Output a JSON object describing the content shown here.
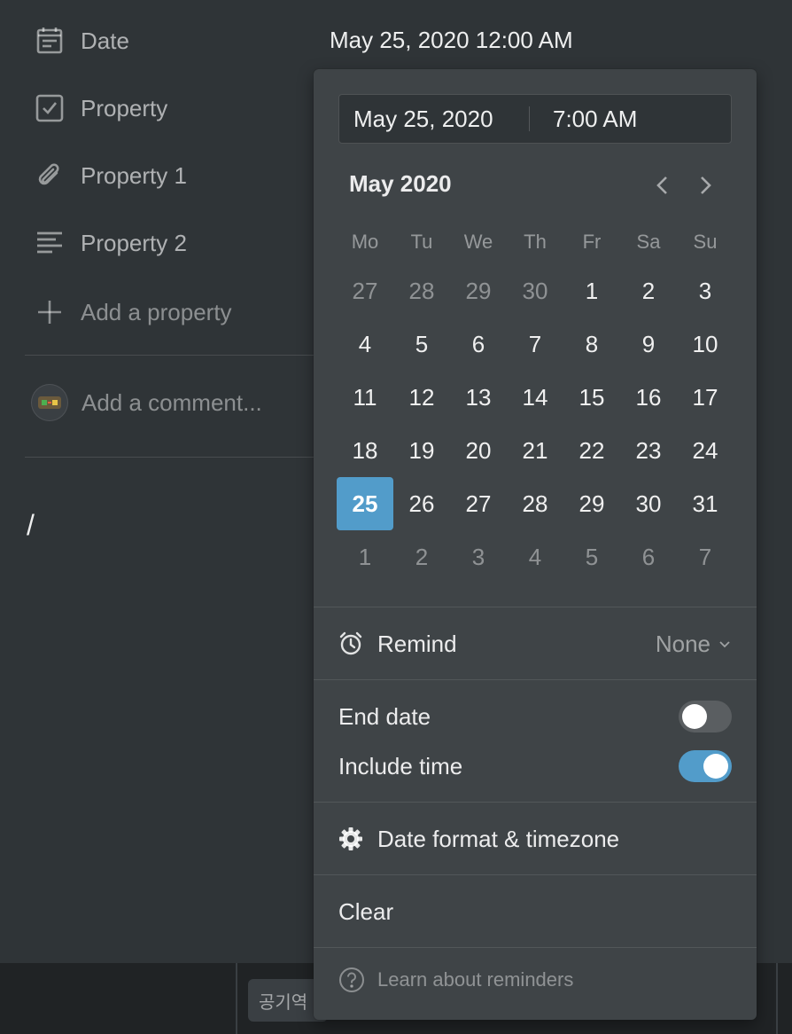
{
  "properties": [
    {
      "icon": "calendar-icon",
      "label": "Date"
    },
    {
      "icon": "checkbox-icon",
      "label": "Property"
    },
    {
      "icon": "paperclip-icon",
      "label": "Property 1"
    },
    {
      "icon": "text-lines-icon",
      "label": "Property 2"
    }
  ],
  "date_value": "May 25, 2020 12:00 AM",
  "add_property_label": "Add a property",
  "comment_placeholder": "Add a comment...",
  "editor_text": "/",
  "bottom_cell_text": "공기역",
  "picker": {
    "date_input": "May 25, 2020",
    "time_input": "7:00 AM",
    "month_title": "May 2020",
    "weekdays": [
      "Mo",
      "Tu",
      "We",
      "Th",
      "Fr",
      "Sa",
      "Su"
    ],
    "weeks": [
      [
        {
          "d": "27",
          "m": true
        },
        {
          "d": "28",
          "m": true
        },
        {
          "d": "29",
          "m": true
        },
        {
          "d": "30",
          "m": true
        },
        {
          "d": "1"
        },
        {
          "d": "2"
        },
        {
          "d": "3"
        }
      ],
      [
        {
          "d": "4"
        },
        {
          "d": "5"
        },
        {
          "d": "6"
        },
        {
          "d": "7"
        },
        {
          "d": "8"
        },
        {
          "d": "9"
        },
        {
          "d": "10"
        }
      ],
      [
        {
          "d": "11"
        },
        {
          "d": "12"
        },
        {
          "d": "13"
        },
        {
          "d": "14"
        },
        {
          "d": "15"
        },
        {
          "d": "16"
        },
        {
          "d": "17"
        }
      ],
      [
        {
          "d": "18"
        },
        {
          "d": "19"
        },
        {
          "d": "20"
        },
        {
          "d": "21"
        },
        {
          "d": "22"
        },
        {
          "d": "23"
        },
        {
          "d": "24"
        }
      ],
      [
        {
          "d": "25",
          "sel": true
        },
        {
          "d": "26"
        },
        {
          "d": "27"
        },
        {
          "d": "28"
        },
        {
          "d": "29"
        },
        {
          "d": "30"
        },
        {
          "d": "31"
        }
      ],
      [
        {
          "d": "1",
          "m": true
        },
        {
          "d": "2",
          "m": true
        },
        {
          "d": "3",
          "m": true
        },
        {
          "d": "4",
          "m": true
        },
        {
          "d": "5",
          "m": true
        },
        {
          "d": "6",
          "m": true
        },
        {
          "d": "7",
          "m": true
        }
      ]
    ],
    "remind_label": "Remind",
    "remind_value": "None",
    "end_date_label": "End date",
    "end_date_on": false,
    "include_time_label": "Include time",
    "include_time_on": true,
    "date_format_label": "Date format & timezone",
    "clear_label": "Clear",
    "help_label": "Learn about reminders"
  },
  "colors": {
    "background": "#2f3437",
    "popover": "#3f4447",
    "accent": "#529cca"
  }
}
